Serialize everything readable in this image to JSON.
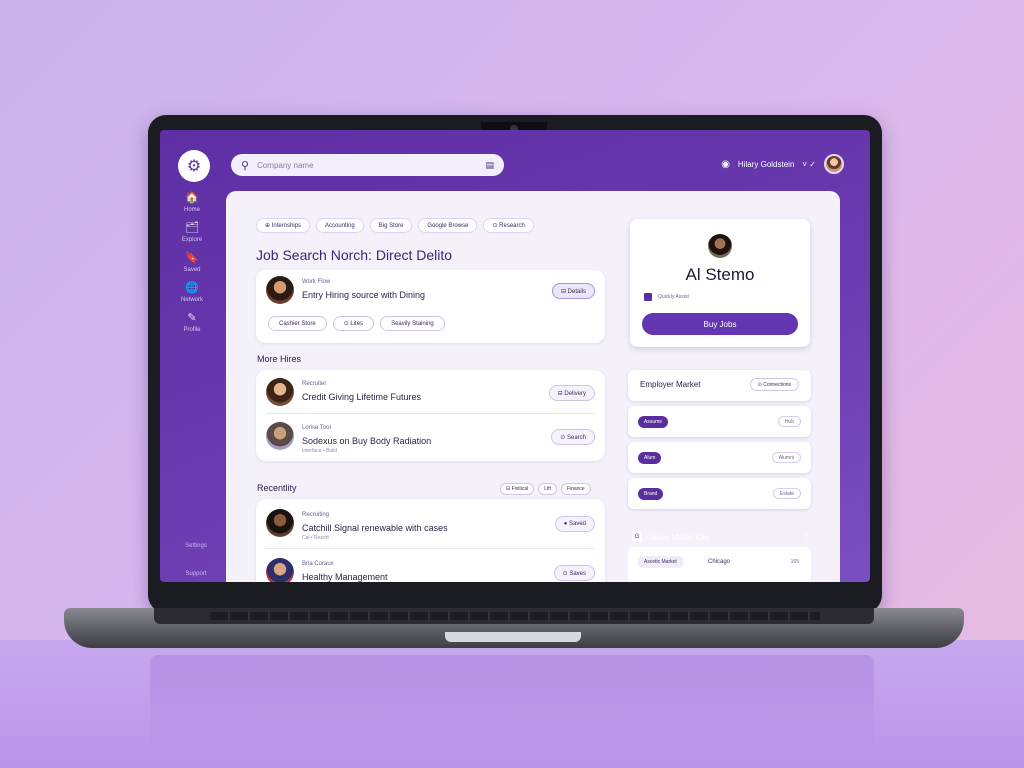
{
  "app": {
    "search_placeholder": "Company name",
    "user_name": "Hilary Goldstein",
    "user_caret": "˅ ✓"
  },
  "sidebar": {
    "items": [
      {
        "label": "Home",
        "icon": "🏠"
      },
      {
        "label": "Explore",
        "icon": "🗂"
      },
      {
        "label": "Saved",
        "icon": "🔖"
      },
      {
        "label": "Network",
        "icon": "🌐"
      },
      {
        "label": "Profile",
        "icon": "✎"
      }
    ],
    "footer": [
      "Settings",
      "Support"
    ]
  },
  "filters": {
    "chips": [
      "⊕ Internships",
      "Accounting",
      "Big Store",
      "Google Browse",
      "⊙ Research"
    ]
  },
  "page_title": "Job Search Norch: Direct Delito",
  "featured": {
    "subtitle": "Work Flow",
    "title": "Entry Hiring source with Dining",
    "button": "⊟ Details",
    "tags": [
      "Cashier Store",
      "⊙ Lites",
      "Seavily Staining"
    ]
  },
  "section_more": "More Hires",
  "more_rows": [
    {
      "subtitle": "Recruiter",
      "title": "Credit Giving Lifetime Futures",
      "button": "⊟ Delivery"
    },
    {
      "subtitle": "Lorise Tool",
      "title": "Sodexus on Buy Body Radiation",
      "meta": "Interface • Build",
      "button": "⊙ Search"
    }
  ],
  "section_recent": "Recentlity",
  "recent_filters": [
    "⊟ Fixitical",
    "Lift",
    "Finance"
  ],
  "recent_rows": [
    {
      "subtitle": "Recruiting",
      "title": "Catchill Signal renewable with cases",
      "meta": "Cal • Resort",
      "button": "● Saved"
    },
    {
      "subtitle": "Bria Coraux",
      "title": "Healthy Management",
      "button": "⊙ Saves"
    }
  ],
  "profile": {
    "name": "Al Stemo",
    "check_label": "Quickly Assist",
    "button": "Buy Jobs"
  },
  "side": {
    "header_title": "Employer Market",
    "header_button": "⊙ Connections",
    "rows": [
      {
        "pill": "Assume",
        "right": "Hub"
      },
      {
        "pill": "Alum",
        "right": "Alumni"
      },
      {
        "pill": "Brand",
        "right": "Estate"
      }
    ]
  },
  "city": {
    "icon": "G",
    "title": "Jasee Model City",
    "caret": "⊤",
    "chip": "Ascetic Market",
    "value": "Chicago",
    "num": "165"
  }
}
